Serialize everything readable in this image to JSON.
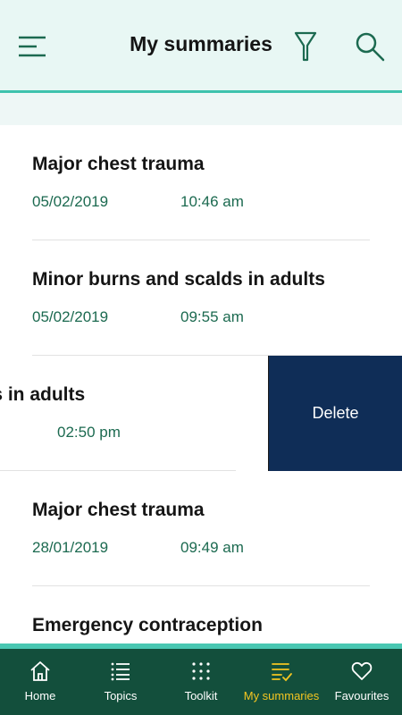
{
  "header": {
    "title": "My summaries",
    "menu_icon": "hamburger-icon",
    "filter_icon": "filter-icon",
    "search_icon": "search-icon"
  },
  "summaries": [
    {
      "title": "Major chest trauma",
      "date": "05/02/2019",
      "time": "10:46 am"
    },
    {
      "title": "Minor burns and scalds in adults",
      "date": "05/02/2019",
      "time": "09:55 am"
    },
    {
      "title": "meningitis in adults",
      "date": "",
      "time": "02:50 pm",
      "delete_label": "Delete"
    },
    {
      "title": "Major chest trauma",
      "date": "28/01/2019",
      "time": "09:49 am"
    },
    {
      "title": "Emergency contraception",
      "date": "",
      "time": ""
    }
  ],
  "nav": [
    {
      "label": "Home",
      "icon": "home-icon"
    },
    {
      "label": "Topics",
      "icon": "list-icon"
    },
    {
      "label": "Toolkit",
      "icon": "grid-icon"
    },
    {
      "label": "My summaries",
      "icon": "summaries-icon",
      "active": true
    },
    {
      "label": "Favourites",
      "icon": "heart-icon"
    }
  ],
  "colors": {
    "header_bg": "#e8f7f4",
    "accent": "#3ec2ad",
    "nav_bg": "#134f3c",
    "active_nav": "#f3c521",
    "meta_text": "#1c6a50",
    "delete_bg": "#0f2d57"
  }
}
